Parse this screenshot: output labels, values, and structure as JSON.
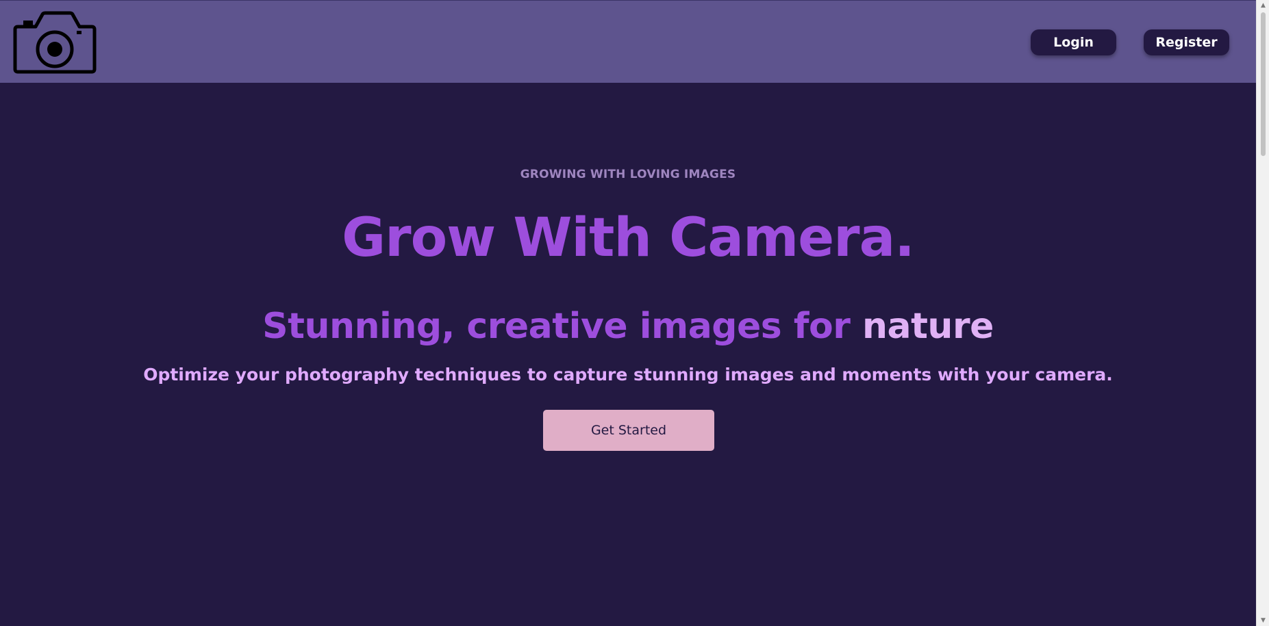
{
  "header": {
    "logo_icon": "camera-icon",
    "login_label": "Login",
    "register_label": "Register"
  },
  "hero": {
    "eyebrow": "GROWING WITH LOVING IMAGES",
    "headline": "Grow With Camera.",
    "subline_main": "Stunning, creative images for ",
    "subline_accent": "nature",
    "tagline": "Optimize your photography techniques to capture stunning images and moments with your camera.",
    "cta_label": "Get Started"
  },
  "colors": {
    "page_background": "#231942",
    "header_background": "#5e548e",
    "headline": "#9d4edd",
    "accent": "#e0b1f5",
    "tagline": "#e0aaff",
    "eyebrow": "#9f86c0",
    "cta_background": "#e0aec7"
  },
  "scrollbar": {
    "up_icon": "chevron-up-icon",
    "down_icon": "chevron-down-icon"
  }
}
